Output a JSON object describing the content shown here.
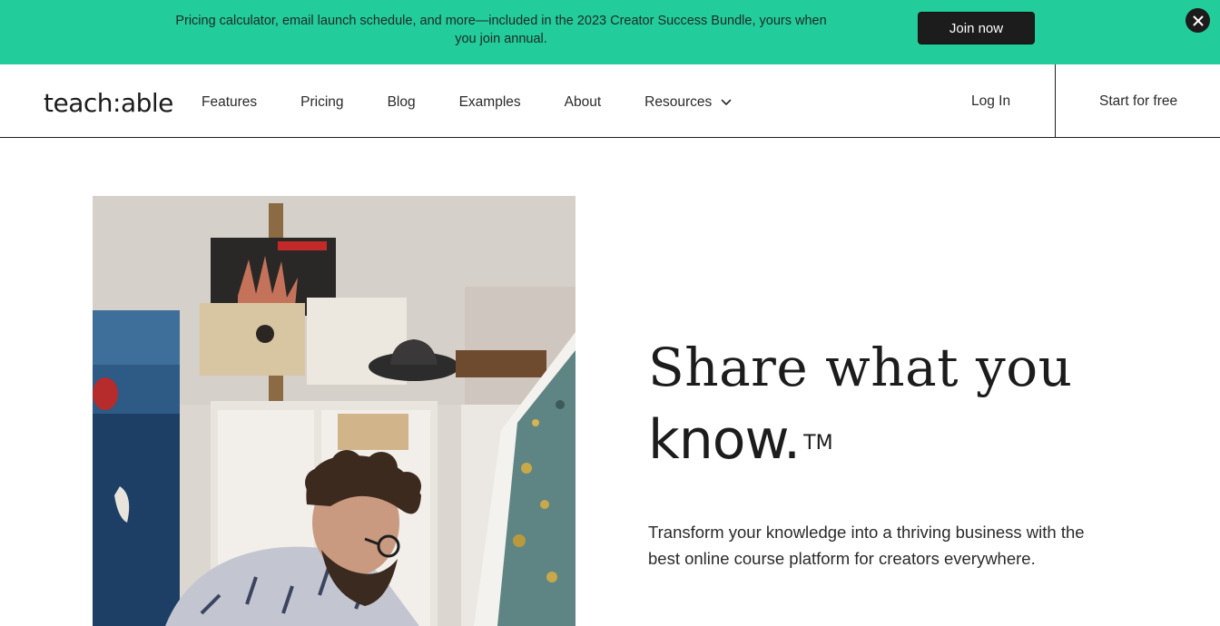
{
  "banner": {
    "text": "Pricing calculator, email launch schedule, and more—included in the 2023 Creator Success Bundle, yours when you join annual.",
    "cta_label": "Join now",
    "close_icon": "close-icon",
    "bg_color": "#22cc9b"
  },
  "nav": {
    "logo": "teach:able",
    "links": [
      "Features",
      "Pricing",
      "Blog",
      "Examples",
      "About",
      "Resources"
    ],
    "resources_icon": "chevron-down-icon",
    "login_label": "Log In",
    "start_label": "Start for free"
  },
  "hero": {
    "headline_line1": "Share what you",
    "headline_line2": "know.",
    "trademark": "TM",
    "subtext": "Transform your knowledge into a thriving business with the best online course platform for creators everywhere.",
    "image_alt": "Artist painting a canvas in a studio"
  }
}
